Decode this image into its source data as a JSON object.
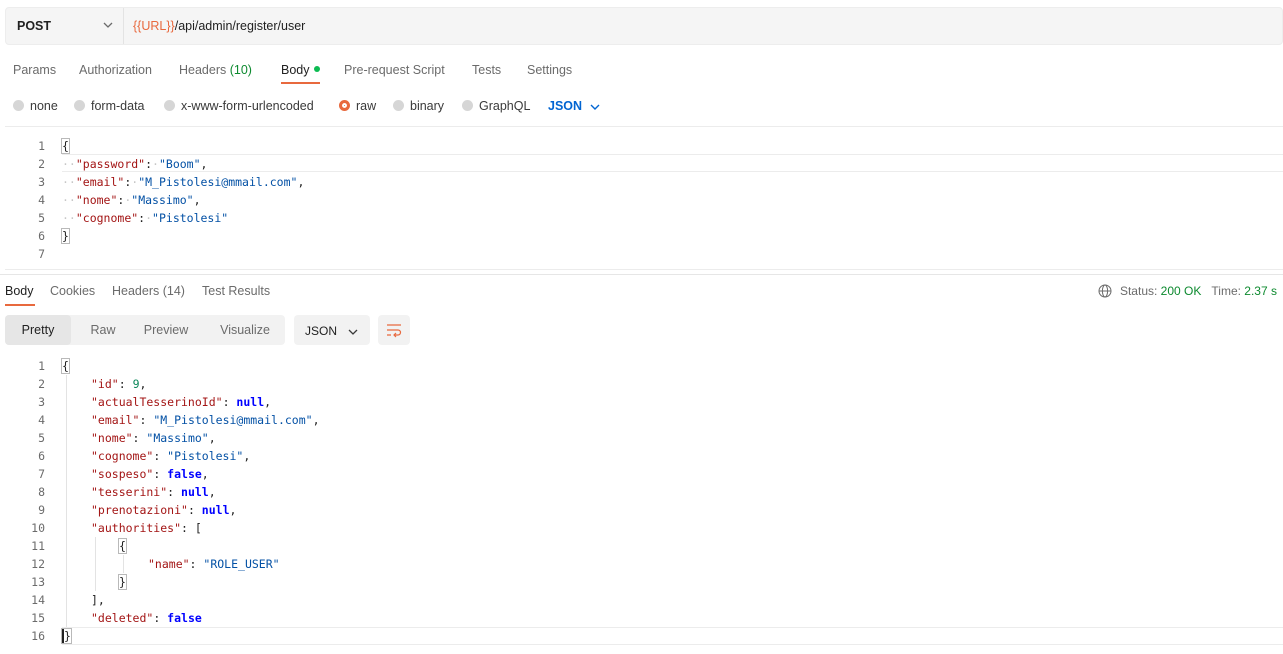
{
  "request": {
    "method": "POST",
    "url_var": "{{URL}}",
    "url_path": "/api/admin/register/user"
  },
  "tabs": [
    {
      "label": "Params"
    },
    {
      "label": "Authorization"
    },
    {
      "label": "Headers",
      "count": "(10)"
    },
    {
      "label": "Body"
    },
    {
      "label": "Pre-request Script"
    },
    {
      "label": "Tests"
    },
    {
      "label": "Settings"
    }
  ],
  "body_types": [
    "none",
    "form-data",
    "x-www-form-urlencoded",
    "raw",
    "binary",
    "GraphQL"
  ],
  "body_lang": "JSON",
  "request_body": {
    "line_numbers": [
      "1",
      "2",
      "3",
      "4",
      "5",
      "6",
      "7"
    ]
  },
  "response_tabs": [
    {
      "label": "Body"
    },
    {
      "label": "Cookies"
    },
    {
      "label": "Headers",
      "count": "(14)"
    },
    {
      "label": "Test Results"
    }
  ],
  "response_meta": {
    "status_label": "Status:",
    "status_value": "200 OK",
    "time_label": "Time:",
    "time_value": "2.37 s"
  },
  "view_modes": [
    "Pretty",
    "Raw",
    "Preview",
    "Visualize"
  ],
  "response_format": "JSON",
  "response_body": {
    "line_numbers": [
      "1",
      "2",
      "3",
      "4",
      "5",
      "6",
      "7",
      "8",
      "9",
      "10",
      "11",
      "12",
      "13",
      "14",
      "15",
      "16"
    ]
  },
  "json_text": {
    "k_password": "\"password\"",
    "v_password": "\"Boom\"",
    "k_email": "\"email\"",
    "v_email": "\"M_Pistolesi@mmail.com\"",
    "k_nome": "\"nome\"",
    "v_nome": "\"Massimo\"",
    "k_cognome": "\"cognome\"",
    "v_cognome": "\"Pistolesi\"",
    "k_id": "\"id\"",
    "v_id": "9",
    "k_actual": "\"actualTesserinoId\"",
    "v_null": "null",
    "k_sospeso": "\"sospeso\"",
    "v_false": "false",
    "k_tesserini": "\"tesserini\"",
    "k_prenotazioni": "\"prenotazioni\"",
    "k_authorities": "\"authorities\"",
    "k_name": "\"name\"",
    "v_role": "\"ROLE_USER\"",
    "k_deleted": "\"deleted\""
  },
  "colors": {
    "accent": "#e8693e",
    "ok": "#0d8a2f",
    "link": "#0265d2"
  }
}
